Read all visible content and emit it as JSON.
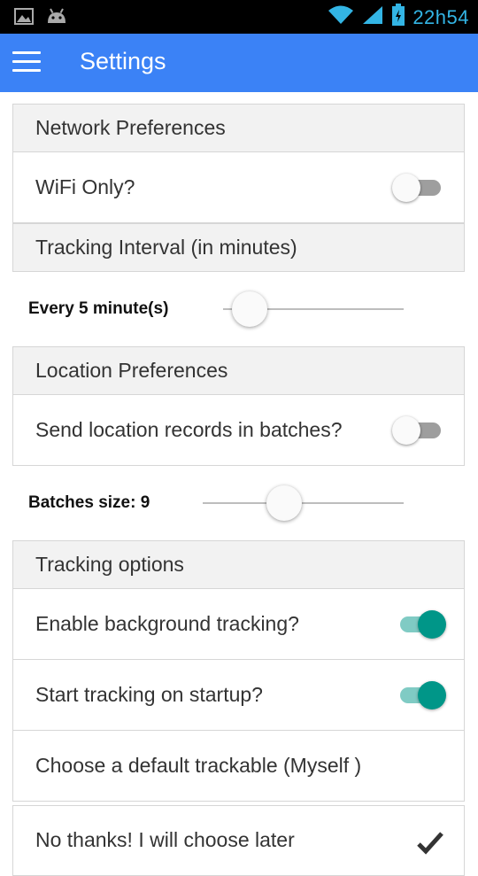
{
  "status_bar": {
    "time": "22h54"
  },
  "app_bar": {
    "title": "Settings"
  },
  "sections": {
    "network": {
      "header": "Network Preferences",
      "wifi_only": {
        "label": "WiFi Only?",
        "enabled": false
      }
    },
    "tracking_interval": {
      "header": "Tracking Interval (in minutes)",
      "slider": {
        "label": "Every 5 minute(s)",
        "value_fraction": 0.15
      }
    },
    "location": {
      "header": "Location Preferences",
      "batches": {
        "label": "Send location records in batches?",
        "enabled": false
      },
      "batch_size": {
        "label": "Batches size: 9",
        "value_fraction": 0.4
      }
    },
    "tracking_options": {
      "header": "Tracking options",
      "background": {
        "label": "Enable background tracking?",
        "enabled": true
      },
      "startup": {
        "label": "Start tracking on startup?",
        "enabled": true
      },
      "default_trackable": {
        "label": "Choose a default trackable (Myself )"
      },
      "choose_later": {
        "label": "No thanks! I will choose later",
        "checked": true
      }
    }
  },
  "colors": {
    "app_bar": "#3b82f6",
    "accent": "#009688",
    "status_icon": "#33b5e5"
  },
  "icons": {
    "status_left": [
      "image-icon",
      "android-icon"
    ],
    "status_right": [
      "wifi-icon",
      "signal-icon",
      "battery-icon"
    ],
    "menu": "menu-icon",
    "check": "check-icon"
  }
}
